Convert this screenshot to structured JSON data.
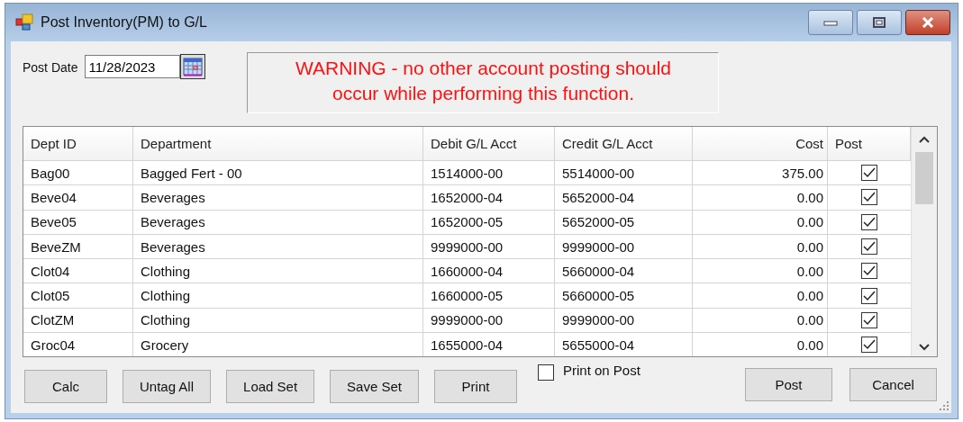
{
  "window": {
    "title": "Post Inventory(PM) to G/L"
  },
  "post_date": {
    "label": "Post Date",
    "value": "11/28/2023"
  },
  "warning": "WARNING - no other account posting should occur while performing this function.",
  "table": {
    "columns": [
      "Dept ID",
      "Department",
      "Debit G/L Acct",
      "Credit G/L Acct",
      "Cost",
      "Post"
    ],
    "rows": [
      {
        "dept_id": "Bag00",
        "department": "Bagged Fert - 00",
        "debit": "1514000-00",
        "credit": "5514000-00",
        "cost": "375.00",
        "post": true
      },
      {
        "dept_id": "Beve04",
        "department": "Beverages",
        "debit": "1652000-04",
        "credit": "5652000-04",
        "cost": "0.00",
        "post": true
      },
      {
        "dept_id": "Beve05",
        "department": "Beverages",
        "debit": "1652000-05",
        "credit": "5652000-05",
        "cost": "0.00",
        "post": true
      },
      {
        "dept_id": "BeveZM",
        "department": "Beverages",
        "debit": "9999000-00",
        "credit": "9999000-00",
        "cost": "0.00",
        "post": true
      },
      {
        "dept_id": "Clot04",
        "department": "Clothing",
        "debit": "1660000-04",
        "credit": "5660000-04",
        "cost": "0.00",
        "post": true
      },
      {
        "dept_id": "Clot05",
        "department": "Clothing",
        "debit": "1660000-05",
        "credit": "5660000-05",
        "cost": "0.00",
        "post": true
      },
      {
        "dept_id": "ClotZM",
        "department": "Clothing",
        "debit": "9999000-00",
        "credit": "9999000-00",
        "cost": "0.00",
        "post": true
      },
      {
        "dept_id": "Groc04",
        "department": "Grocery",
        "debit": "1655000-04",
        "credit": "5655000-04",
        "cost": "0.00",
        "post": true
      }
    ]
  },
  "left_buttons": [
    "Calc",
    "Untag All",
    "Load Set",
    "Save Set",
    "Print"
  ],
  "print_on_post": {
    "label": "Print on Post",
    "checked": false
  },
  "right_buttons": [
    "Post",
    "Cancel"
  ]
}
